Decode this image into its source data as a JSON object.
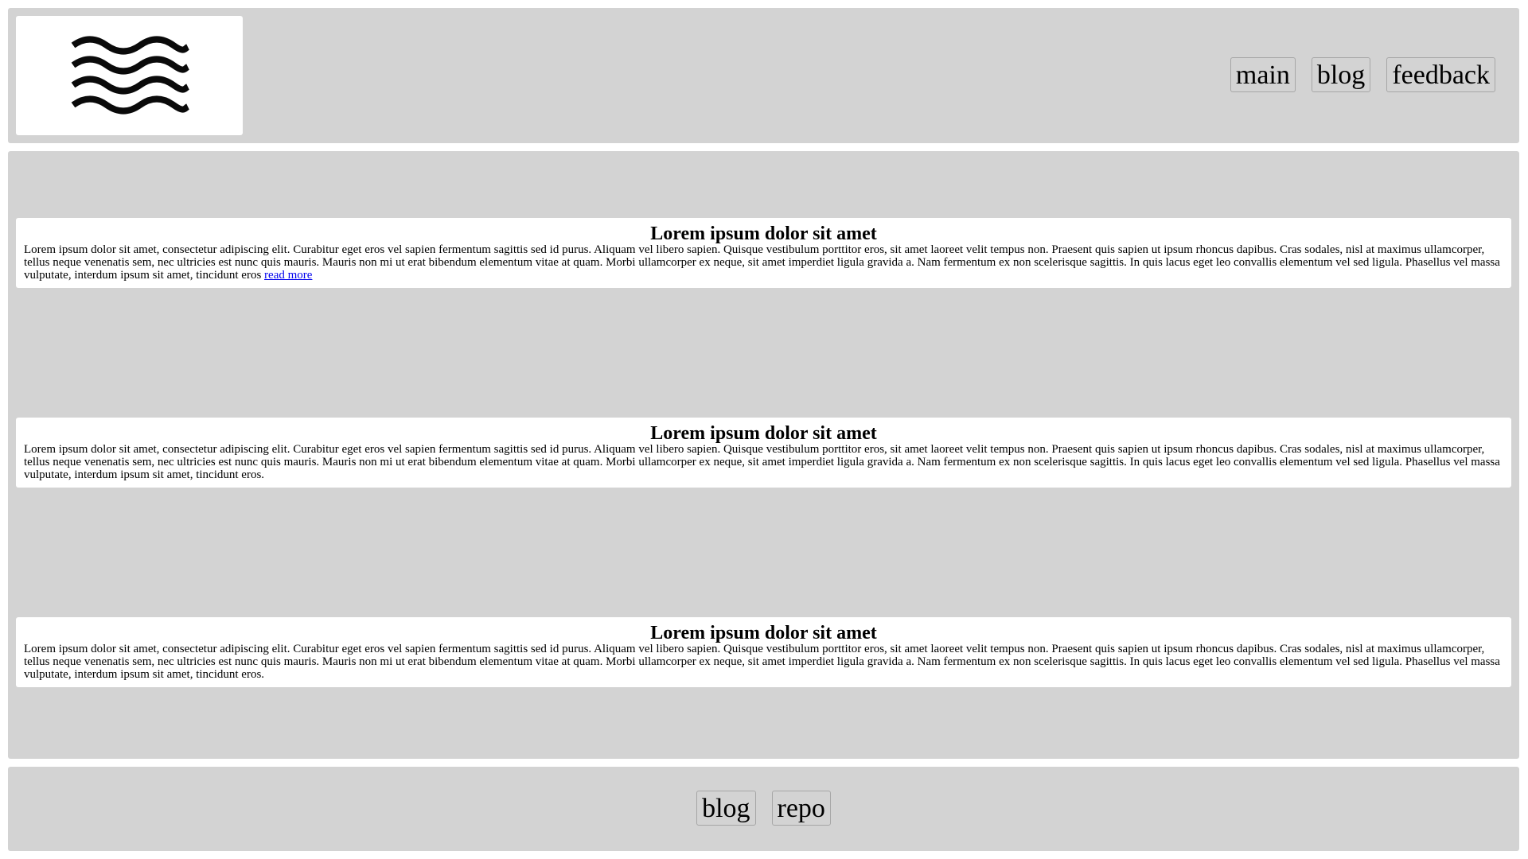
{
  "header": {
    "logo_icon": "wave-lines-icon",
    "nav": [
      {
        "label": "main"
      },
      {
        "label": "blog"
      },
      {
        "label": "feedback"
      }
    ]
  },
  "articles": [
    {
      "title": "Lorem ipsum dolor sit amet",
      "body": "Lorem ipsum dolor sit amet, consectetur adipiscing elit. Curabitur eget eros vel sapien fermentum sagittis sed id purus. Aliquam vel libero sapien. Quisque vestibulum porttitor eros, sit amet laoreet velit tempus non. Praesent quis sapien ut ipsum rhoncus dapibus. Cras sodales, nisl at maximus ullamcorper, tellus neque venenatis sem, nec ultricies est nunc quis mauris. Mauris non mi ut erat bibendum elementum vitae at quam. Morbi ullamcorper ex neque, sit amet imperdiet ligula gravida a. Nam fermentum ex non scelerisque sagittis. In quis lacus eget leo convallis elementum vel sed ligula. Phasellus vel massa vulputate, interdum ipsum sit amet, tincidunt eros",
      "link": "read more"
    },
    {
      "title": "Lorem ipsum dolor sit amet",
      "body": "Lorem ipsum dolor sit amet, consectetur adipiscing elit. Curabitur eget eros vel sapien fermentum sagittis sed id purus. Aliquam vel libero sapien. Quisque vestibulum porttitor eros, sit amet laoreet velit tempus non. Praesent quis sapien ut ipsum rhoncus dapibus. Cras sodales, nisl at maximus ullamcorper, tellus neque venenatis sem, nec ultricies est nunc quis mauris. Mauris non mi ut erat bibendum elementum vitae at quam. Morbi ullamcorper ex neque, sit amet imperdiet ligula gravida a. Nam fermentum ex non scelerisque sagittis. In quis lacus eget leo convallis elementum vel sed ligula. Phasellus vel massa vulputate, interdum ipsum sit amet, tincidunt eros."
    },
    {
      "title": "Lorem ipsum dolor sit amet",
      "body": "Lorem ipsum dolor sit amet, consectetur adipiscing elit. Curabitur eget eros vel sapien fermentum sagittis sed id purus. Aliquam vel libero sapien. Quisque vestibulum porttitor eros, sit amet laoreet velit tempus non. Praesent quis sapien ut ipsum rhoncus dapibus. Cras sodales, nisl at maximus ullamcorper, tellus neque venenatis sem, nec ultricies est nunc quis mauris. Mauris non mi ut erat bibendum elementum vitae at quam. Morbi ullamcorper ex neque, sit amet imperdiet ligula gravida a. Nam fermentum ex non scelerisque sagittis. In quis lacus eget leo convallis elementum vel sed ligula. Phasellus vel massa vulputate, interdum ipsum sit amet, tincidunt eros."
    }
  ],
  "footer": {
    "nav": [
      {
        "label": "blog"
      },
      {
        "label": "repo"
      }
    ]
  },
  "colors": {
    "panel_background": "#d3d3d3",
    "card_background": "#ffffff",
    "link": "#0000ee"
  }
}
